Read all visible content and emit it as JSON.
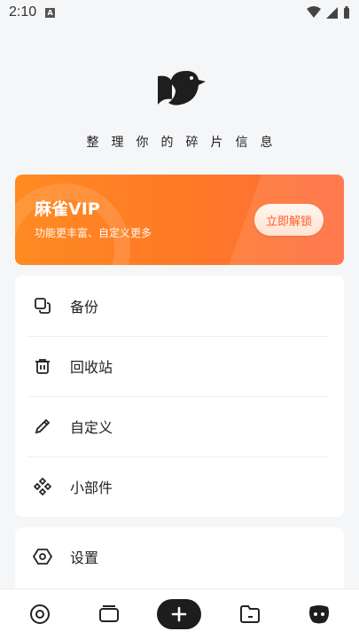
{
  "status_bar": {
    "time": "2:10",
    "app_badge": "A"
  },
  "tagline": "整理你的碎片信息",
  "vip": {
    "title": "麻雀VIP",
    "subtitle": "功能更丰富、自定义更多",
    "unlock_label": "立即解锁"
  },
  "menu": {
    "items": [
      {
        "label": "备份",
        "icon": "copy-icon"
      },
      {
        "label": "回收站",
        "icon": "trash-icon"
      },
      {
        "label": "自定义",
        "icon": "pencil-icon"
      },
      {
        "label": "小部件",
        "icon": "widgets-icon"
      }
    ]
  },
  "settings": {
    "label": "设置",
    "icon": "hexagon-settings-icon"
  },
  "bottom_nav": {
    "items": [
      {
        "icon": "circle-dot-icon"
      },
      {
        "icon": "cards-icon"
      },
      {
        "icon": "plus-icon"
      },
      {
        "icon": "folder-icon"
      },
      {
        "icon": "profile-face-icon"
      }
    ]
  },
  "colors": {
    "accent": "#ff7a26",
    "vip_text": "#ff5b2d",
    "nav_add_bg": "#1d1d1d"
  }
}
